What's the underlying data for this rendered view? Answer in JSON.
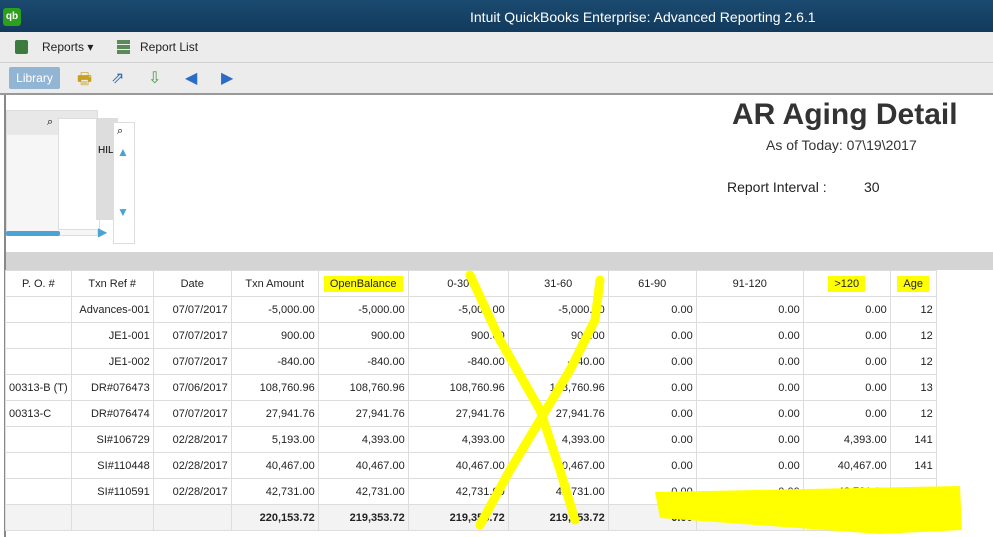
{
  "window": {
    "title": "Intuit QuickBooks Enterprise: Advanced Reporting 2.6.1",
    "logo": "qb"
  },
  "menu": {
    "reports": "Reports ▾",
    "report_list": "Report List"
  },
  "toolbar": {
    "library": "Library"
  },
  "filter": {
    "partial_text": "HIL"
  },
  "report": {
    "title": "AR Aging Detail",
    "as_of": "As of Today: 07\\19\\2017",
    "interval_label": "Report Interval :",
    "interval_value": "30"
  },
  "table": {
    "headers": [
      "P. O. #",
      "Txn Ref #",
      "Date",
      "Txn Amount",
      "OpenBalance",
      "0-30",
      "31-60",
      "61-90",
      "91-120",
      ">120",
      "Age"
    ],
    "rows": [
      [
        "",
        "Advances-001",
        "07/07/2017",
        "-5,000.00",
        "-5,000.00",
        "-5,000.00",
        "-5,000.00",
        "0.00",
        "0.00",
        "0.00",
        "12"
      ],
      [
        "",
        "JE1-001",
        "07/07/2017",
        "900.00",
        "900.00",
        "900.00",
        "900.00",
        "0.00",
        "0.00",
        "0.00",
        "12"
      ],
      [
        "",
        "JE1-002",
        "07/07/2017",
        "-840.00",
        "-840.00",
        "-840.00",
        "-840.00",
        "0.00",
        "0.00",
        "0.00",
        "12"
      ],
      [
        "00313-B (T)",
        "DR#076473",
        "07/06/2017",
        "108,760.96",
        "108,760.96",
        "108,760.96",
        "108,760.96",
        "0.00",
        "0.00",
        "0.00",
        "13"
      ],
      [
        "00313-C",
        "DR#076474",
        "07/07/2017",
        "27,941.76",
        "27,941.76",
        "27,941.76",
        "27,941.76",
        "0.00",
        "0.00",
        "0.00",
        "12"
      ],
      [
        "",
        "SI#106729",
        "02/28/2017",
        "5,193.00",
        "4,393.00",
        "4,393.00",
        "4,393.00",
        "0.00",
        "0.00",
        "4,393.00",
        "141"
      ],
      [
        "",
        "SI#110448",
        "02/28/2017",
        "40,467.00",
        "40,467.00",
        "40,467.00",
        "40,467.00",
        "0.00",
        "0.00",
        "40,467.00",
        "141"
      ],
      [
        "",
        "SI#110591",
        "02/28/2017",
        "42,731.00",
        "42,731.00",
        "42,731.00",
        "42,731.00",
        "0.00",
        "0.00",
        "42,731.00",
        "141"
      ]
    ],
    "totals": [
      "",
      "",
      "",
      "220,153.72",
      "219,353.72",
      "219,353.72",
      "219,353.72",
      "0.00",
      "0.00",
      "0.00",
      ""
    ]
  },
  "colors": {
    "highlight": "#ffff00",
    "titlebar": "#123a5c"
  }
}
